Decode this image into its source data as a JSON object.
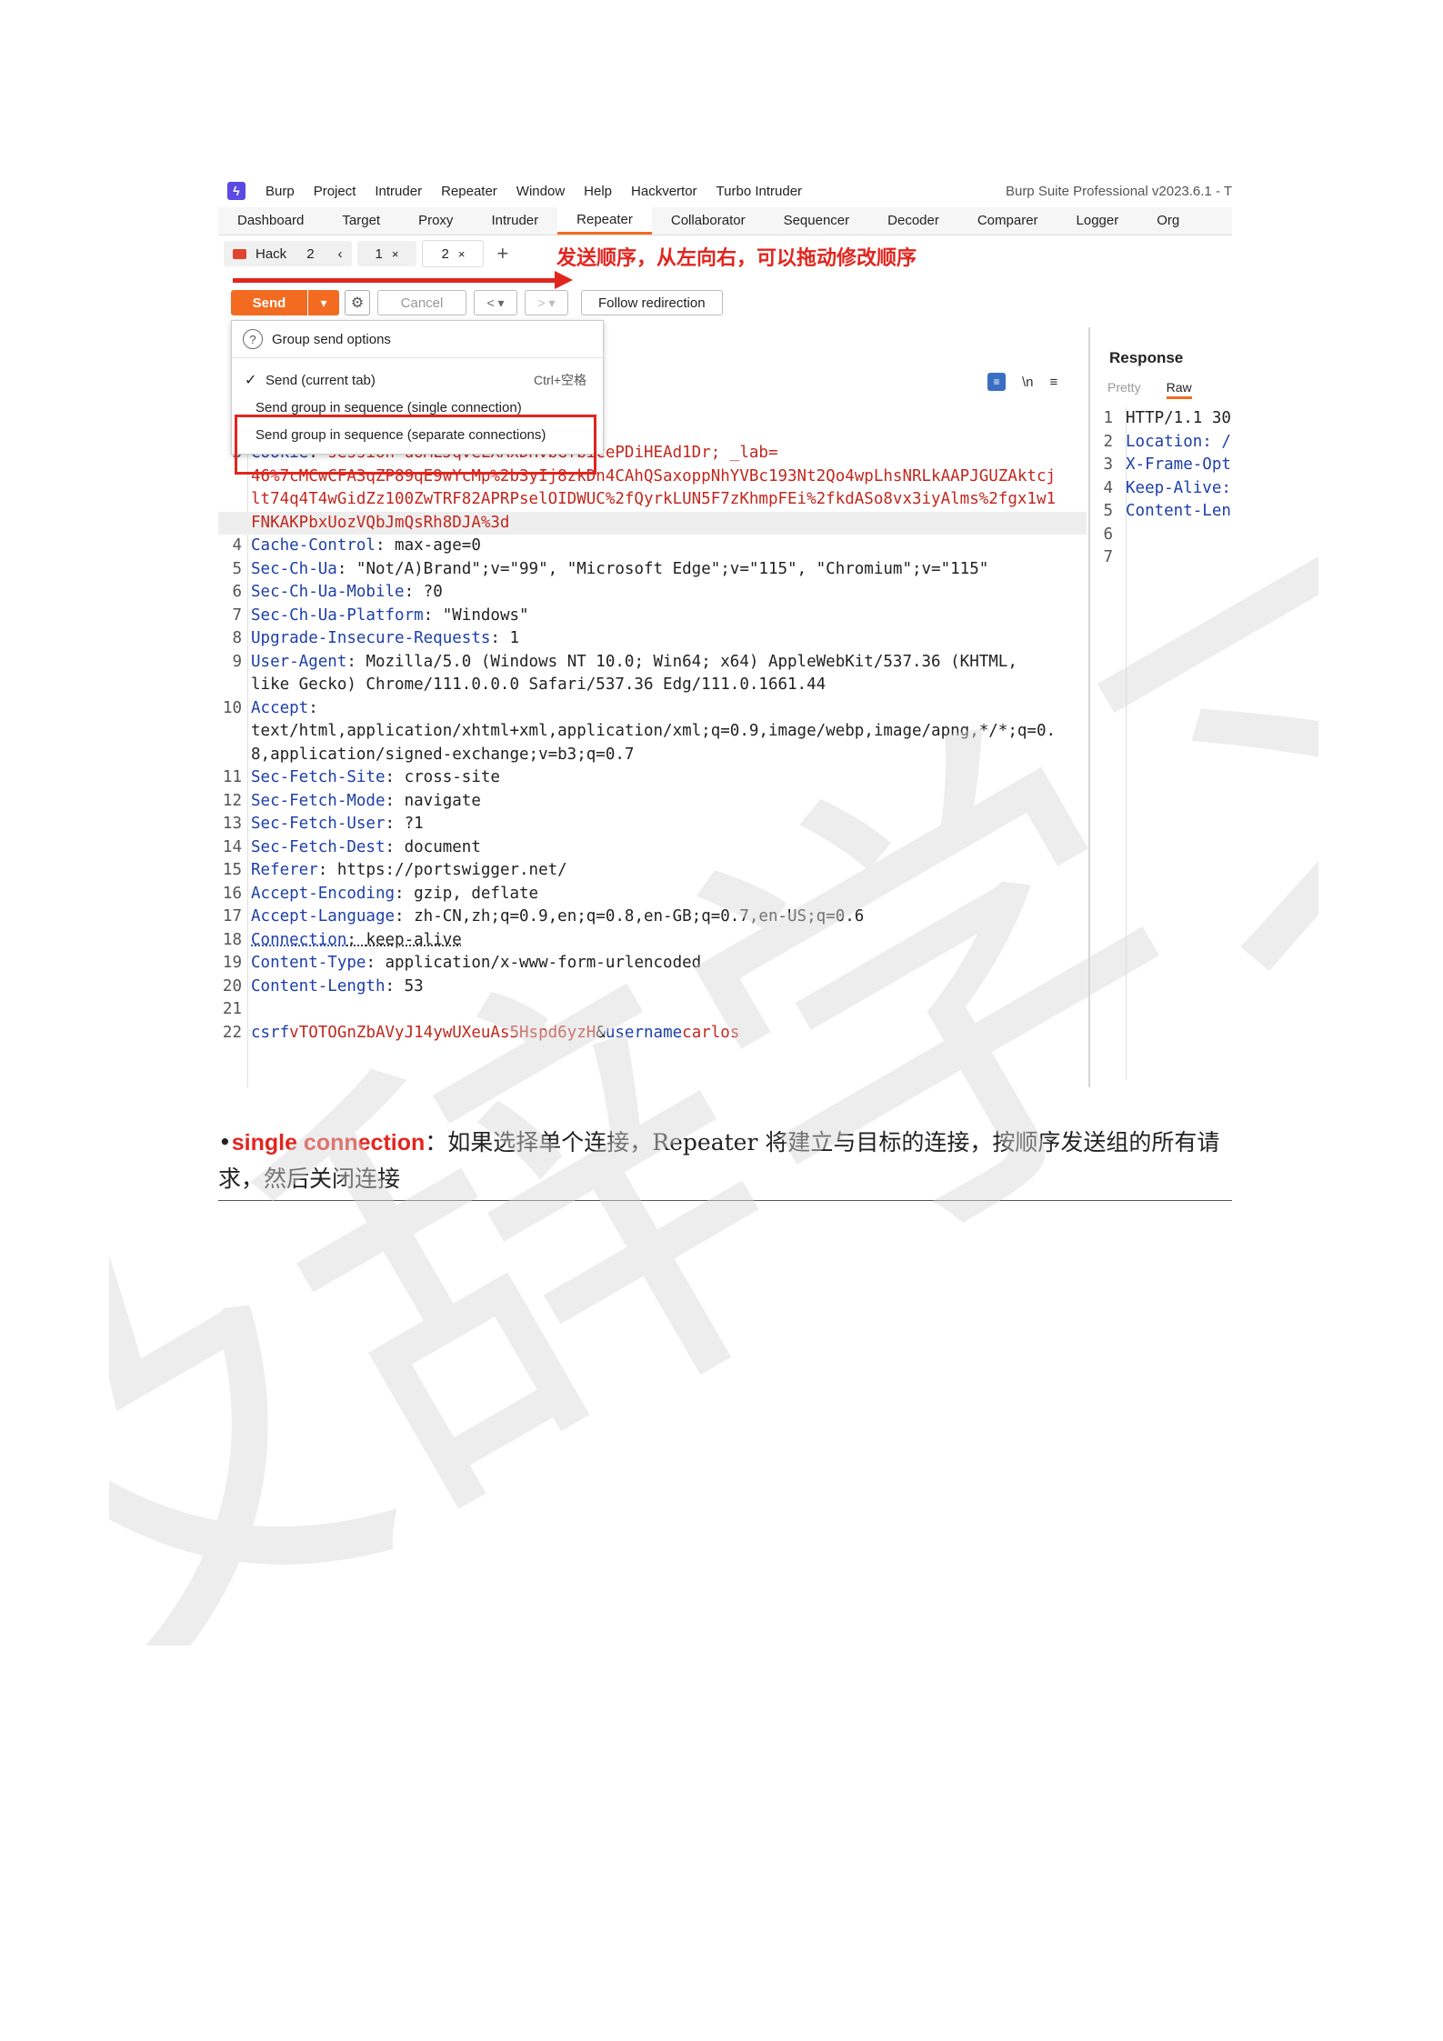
{
  "menubar": {
    "items": [
      "Burp",
      "Project",
      "Intruder",
      "Repeater",
      "Window",
      "Help",
      "Hackvertor",
      "Turbo Intruder"
    ],
    "app_title": "Burp Suite Professional v2023.6.1 - T"
  },
  "tabs": [
    "Dashboard",
    "Target",
    "Proxy",
    "Intruder",
    "Repeater",
    "Collaborator",
    "Sequencer",
    "Decoder",
    "Comparer",
    "Logger",
    "Org"
  ],
  "active_tab": "Repeater",
  "subtabs": {
    "group_name": "Hack",
    "group_count": "2",
    "tab1": "1",
    "tab2": "2",
    "close": "×",
    "prev": "‹",
    "add": "+"
  },
  "annotation": "发送顺序，从左向右，可以拖动修改顺序",
  "toolbar": {
    "send": "Send",
    "cancel": "Cancel",
    "follow": "Follow redirection"
  },
  "dropdown": {
    "header": "Group send options",
    "items": [
      {
        "check": "✓",
        "label": "Send (current tab)",
        "shortcut": "Ctrl+空格"
      },
      {
        "check": "",
        "label": "Send group in sequence (single connection)",
        "shortcut": ""
      },
      {
        "check": "",
        "label": "Send group in sequence (separate connections)",
        "shortcut": ""
      }
    ]
  },
  "editor_icons": {
    "newline": "\\n",
    "menu": "≡"
  },
  "request_lines": [
    {
      "n": "3",
      "name": "Cookie",
      "sep": ": ",
      "value": "",
      "cookie": "session=uoMLJqveLXAxDHvbGfbicePDiHEAd1Dr; _lab="
    },
    {
      "n": "",
      "name": "",
      "sep": "",
      "value": "",
      "cookie": "46%7cMCwCFA3qZP89qE9wYcMp%2b3yIj8zkDn4CAhQSaxoppNhYVBc193Nt2Qo4wpLhsNRLkAAPJGUZAktcj"
    },
    {
      "n": "",
      "name": "",
      "sep": "",
      "value": "",
      "cookie": "lt74q4T4wGidZz100ZwTRF82APRPselOIDWUC%2fQyrkLUN5F7zKhmpFEi%2fkdASo8vx3iyAlms%2fgx1w1"
    },
    {
      "n": "",
      "name": "",
      "sep": "",
      "value": "",
      "cookie": "FNKAKPbxUozVQbJmQsRh8DJA%3d"
    },
    {
      "n": "4",
      "name": "Cache-Control",
      "sep": ": ",
      "value": "max-age=0",
      "cookie": ""
    },
    {
      "n": "5",
      "name": "Sec-Ch-Ua",
      "sep": ": ",
      "value": "\"Not/A)Brand\";v=\"99\", \"Microsoft Edge\";v=\"115\", \"Chromium\";v=\"115\"",
      "cookie": ""
    },
    {
      "n": "6",
      "name": "Sec-Ch-Ua-Mobile",
      "sep": ": ",
      "value": "?0",
      "cookie": ""
    },
    {
      "n": "7",
      "name": "Sec-Ch-Ua-Platform",
      "sep": ": ",
      "value": "\"Windows\"",
      "cookie": ""
    },
    {
      "n": "8",
      "name": "Upgrade-Insecure-Requests",
      "sep": ": ",
      "value": "1",
      "cookie": ""
    },
    {
      "n": "9",
      "name": "User-Agent",
      "sep": ": ",
      "value": "Mozilla/5.0 (Windows NT 10.0; Win64; x64) AppleWebKit/537.36 (KHTML,",
      "cookie": ""
    },
    {
      "n": "",
      "name": "",
      "sep": "",
      "value": "like Gecko) Chrome/111.0.0.0 Safari/537.36 Edg/111.0.1661.44",
      "cookie": ""
    },
    {
      "n": "10",
      "name": "Accept",
      "sep": ":",
      "value": "",
      "cookie": ""
    },
    {
      "n": "",
      "name": "",
      "sep": "",
      "value": "text/html,application/xhtml+xml,application/xml;q=0.9,image/webp,image/apng,*/*;q=0.",
      "cookie": ""
    },
    {
      "n": "",
      "name": "",
      "sep": "",
      "value": "8,application/signed-exchange;v=b3;q=0.7",
      "cookie": ""
    },
    {
      "n": "11",
      "name": "Sec-Fetch-Site",
      "sep": ": ",
      "value": "cross-site",
      "cookie": ""
    },
    {
      "n": "12",
      "name": "Sec-Fetch-Mode",
      "sep": ": ",
      "value": "navigate",
      "cookie": ""
    },
    {
      "n": "13",
      "name": "Sec-Fetch-User",
      "sep": ": ",
      "value": "?1",
      "cookie": ""
    },
    {
      "n": "14",
      "name": "Sec-Fetch-Dest",
      "sep": ": ",
      "value": "document",
      "cookie": ""
    },
    {
      "n": "15",
      "name": "Referer",
      "sep": ": ",
      "value": "https://portswigger.net/",
      "cookie": ""
    },
    {
      "n": "16",
      "name": "Accept-Encoding",
      "sep": ": ",
      "value": "gzip, deflate",
      "cookie": ""
    },
    {
      "n": "17",
      "name": "Accept-Language",
      "sep": ": ",
      "value": "zh-CN,zh;q=0.9,en;q=0.8,en-GB;q=0.7,en-US;q=0.6",
      "cookie": ""
    },
    {
      "n": "18",
      "name": "Connection",
      "sep": ": ",
      "value": "keep-alive",
      "cookie": ""
    },
    {
      "n": "19",
      "name": "Content-Type",
      "sep": ": ",
      "value": "application/x-www-form-urlencoded",
      "cookie": ""
    },
    {
      "n": "20",
      "name": "Content-Length",
      "sep": ": ",
      "value": "53",
      "cookie": ""
    },
    {
      "n": "21",
      "name": "",
      "sep": "",
      "value": "",
      "cookie": ""
    },
    {
      "n": "22",
      "name": "",
      "sep": "",
      "value": "",
      "cookie": "",
      "body": true
    }
  ],
  "body_params": {
    "k1": "csrf",
    "v1": "vTOTOGnZbAVyJ14ywUXeuAs5Hspd6yzH",
    "amp": "&",
    "k2": "username",
    "v2": "carlos"
  },
  "response": {
    "title": "Response",
    "tabs": [
      "Pretty",
      "Raw"
    ],
    "active_tab": "Raw",
    "lines": [
      {
        "n": "1",
        "text": "HTTP/1.1 30",
        "kind": "plain"
      },
      {
        "n": "2",
        "text": "Location: /",
        "kind": "header"
      },
      {
        "n": "3",
        "text": "X-Frame-Opt",
        "kind": "header"
      },
      {
        "n": "4",
        "text": "Keep-Alive:",
        "kind": "header"
      },
      {
        "n": "5",
        "text": "Content-Len",
        "kind": "header"
      },
      {
        "n": "6",
        "text": "",
        "kind": "plain"
      },
      {
        "n": "7",
        "text": "",
        "kind": "plain"
      }
    ]
  },
  "caption": {
    "bullet": "•",
    "term": "single connection",
    "colon": "：",
    "text": "如果选择单个连接，Repeater 将建立与目标的连接，按顺序发送组的所有请求，然后关闭连接"
  },
  "watermark": "及辞学习"
}
